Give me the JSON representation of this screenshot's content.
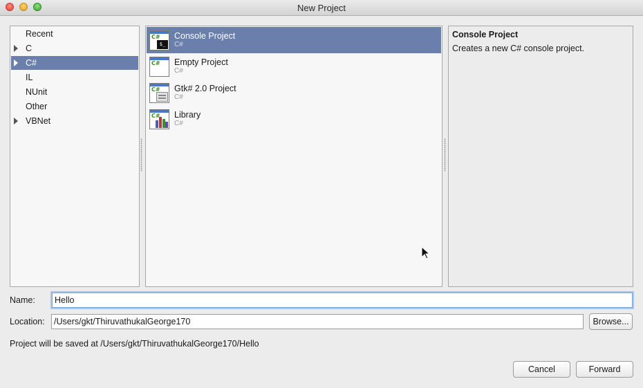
{
  "window": {
    "title": "New Project"
  },
  "categories": [
    {
      "label": "Recent",
      "expandable": false,
      "selected": false
    },
    {
      "label": "C",
      "expandable": true,
      "selected": false
    },
    {
      "label": "C#",
      "expandable": true,
      "selected": true
    },
    {
      "label": "IL",
      "expandable": false,
      "selected": false
    },
    {
      "label": "NUnit",
      "expandable": false,
      "selected": false
    },
    {
      "label": "Other",
      "expandable": false,
      "selected": false
    },
    {
      "label": "VBNet",
      "expandable": true,
      "selected": false
    }
  ],
  "templates": [
    {
      "name": "Console Project",
      "language": "C#",
      "icon": "console-project-icon",
      "selected": true,
      "icon_text": "$_"
    },
    {
      "name": "Empty Project",
      "language": "C#",
      "icon": "empty-project-icon",
      "selected": false
    },
    {
      "name": "Gtk# 2.0 Project",
      "language": "C#",
      "icon": "gtk-project-icon",
      "selected": false
    },
    {
      "name": "Library",
      "language": "C#",
      "icon": "library-project-icon",
      "selected": false
    }
  ],
  "icon_badge": "C#",
  "description": {
    "title": "Console Project",
    "text": "Creates a new C# console project."
  },
  "form": {
    "name_label": "Name:",
    "name_value": "Hello",
    "location_label": "Location:",
    "location_value": "/Users/gkt/ThiruvathukalGeorge170",
    "browse_label": "Browse...",
    "save_path_text": "Project will be saved at /Users/gkt/ThiruvathukalGeorge170/Hello"
  },
  "buttons": {
    "cancel": "Cancel",
    "forward": "Forward"
  },
  "colors": {
    "selection": "#6b7fad",
    "focus_ring": "#a9c6ea"
  }
}
